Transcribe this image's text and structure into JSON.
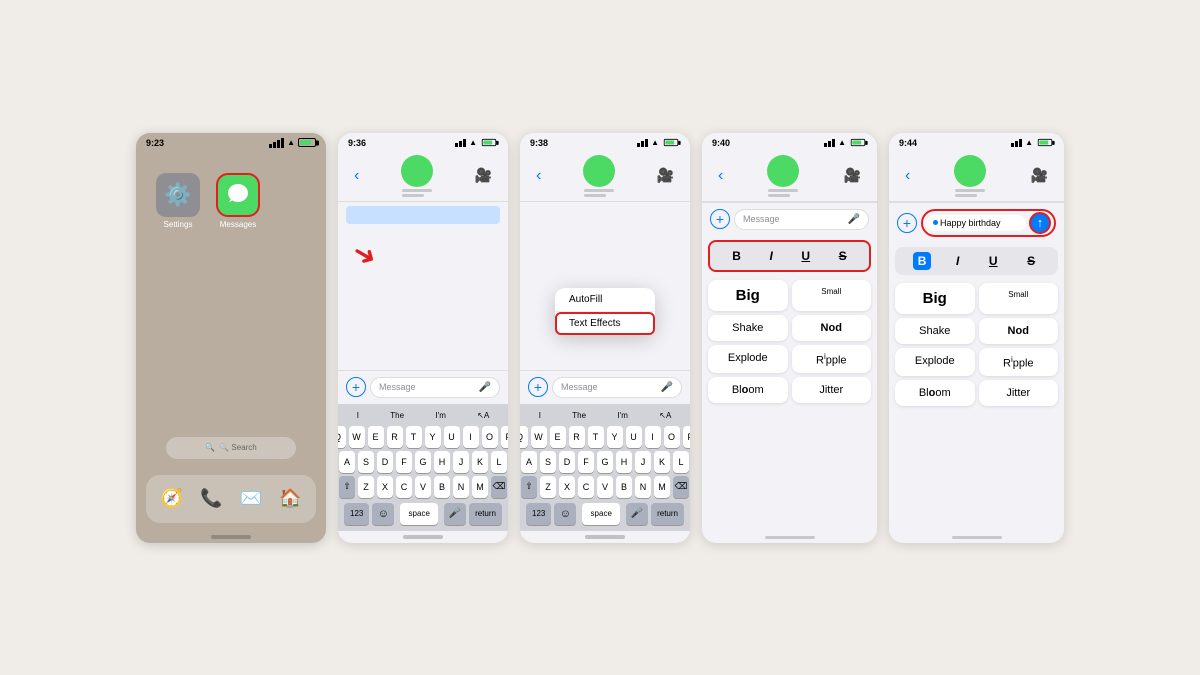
{
  "screens": [
    {
      "id": "screen1",
      "time": "9:23",
      "type": "home",
      "apps": [
        {
          "name": "Settings",
          "label": "Settings",
          "emoji": "⚙️",
          "color": "#8e8e93"
        },
        {
          "name": "Messages",
          "label": "Messages",
          "emoji": "💬",
          "color": "#4cd964",
          "highlighted": true
        }
      ],
      "dock": [
        "🧭",
        "📞",
        "✉️",
        "🏠"
      ],
      "search_label": "🔍 Search"
    },
    {
      "id": "screen2",
      "time": "9:36",
      "type": "messages_keyboard",
      "has_arrow": true,
      "keyboard": {
        "suggestions": [
          "I",
          "The",
          "I'm",
          "↖A"
        ],
        "rows": [
          [
            "Q",
            "W",
            "E",
            "R",
            "T",
            "Y",
            "U",
            "I",
            "O",
            "P"
          ],
          [
            "A",
            "S",
            "D",
            "F",
            "G",
            "H",
            "J",
            "K",
            "L"
          ],
          [
            "⇧",
            "Z",
            "X",
            "C",
            "V",
            "B",
            "N",
            "M",
            "⌫"
          ],
          [
            "123",
            "space",
            "return"
          ]
        ]
      }
    },
    {
      "id": "screen3",
      "time": "9:38",
      "type": "messages_popup",
      "popup_items": [
        "AutoFill",
        "Text Effects"
      ],
      "highlighted_popup": "Text Effects",
      "keyboard": {
        "suggestions": [
          "I",
          "The",
          "I'm",
          "↖A"
        ],
        "rows": [
          [
            "Q",
            "W",
            "E",
            "R",
            "T",
            "Y",
            "U",
            "I",
            "O",
            "P"
          ],
          [
            "A",
            "S",
            "D",
            "F",
            "G",
            "H",
            "J",
            "K",
            "L"
          ],
          [
            "⇧",
            "Z",
            "X",
            "C",
            "V",
            "B",
            "N",
            "M",
            "⌫"
          ],
          [
            "123",
            "space",
            "return"
          ]
        ]
      }
    },
    {
      "id": "screen4",
      "time": "9:40",
      "type": "text_effects",
      "formatting": [
        "B",
        "I",
        "U",
        "S"
      ],
      "effects": [
        {
          "label": "Big",
          "style": "big"
        },
        {
          "label": "Small",
          "style": "small"
        },
        {
          "label": "Shake",
          "style": "normal"
        },
        {
          "label": "Nod",
          "style": "normal"
        },
        {
          "label": "Explode",
          "style": "normal"
        },
        {
          "label": "Ripple",
          "style": "normal"
        },
        {
          "label": "Bloom",
          "style": "bloom"
        },
        {
          "label": "Jitter",
          "style": "normal"
        }
      ]
    },
    {
      "id": "screen5",
      "time": "9:44",
      "type": "text_effects_active",
      "input_text": "Happy birthday",
      "formatting": [
        "B",
        "I",
        "U",
        "S"
      ],
      "active_format": "B",
      "effects": [
        {
          "label": "Big",
          "style": "big"
        },
        {
          "label": "Small",
          "style": "small"
        },
        {
          "label": "Shake",
          "style": "normal"
        },
        {
          "label": "Nod",
          "style": "normal"
        },
        {
          "label": "Explode",
          "style": "normal"
        },
        {
          "label": "Ripple",
          "style": "ripple"
        },
        {
          "label": "Bloom",
          "style": "bloom"
        },
        {
          "label": "Jitter",
          "style": "normal"
        }
      ]
    }
  ],
  "labels": {
    "message_placeholder": "Message",
    "space_key": "space",
    "return_key": "return",
    "autofill": "AutoFill",
    "text_effects": "Text Effects",
    "search": "🔍 Search"
  },
  "colors": {
    "blue": "#007aff",
    "green": "#4cd964",
    "red": "#e02020",
    "gray": "#8e8e93",
    "light_gray": "#f2f2f7"
  }
}
